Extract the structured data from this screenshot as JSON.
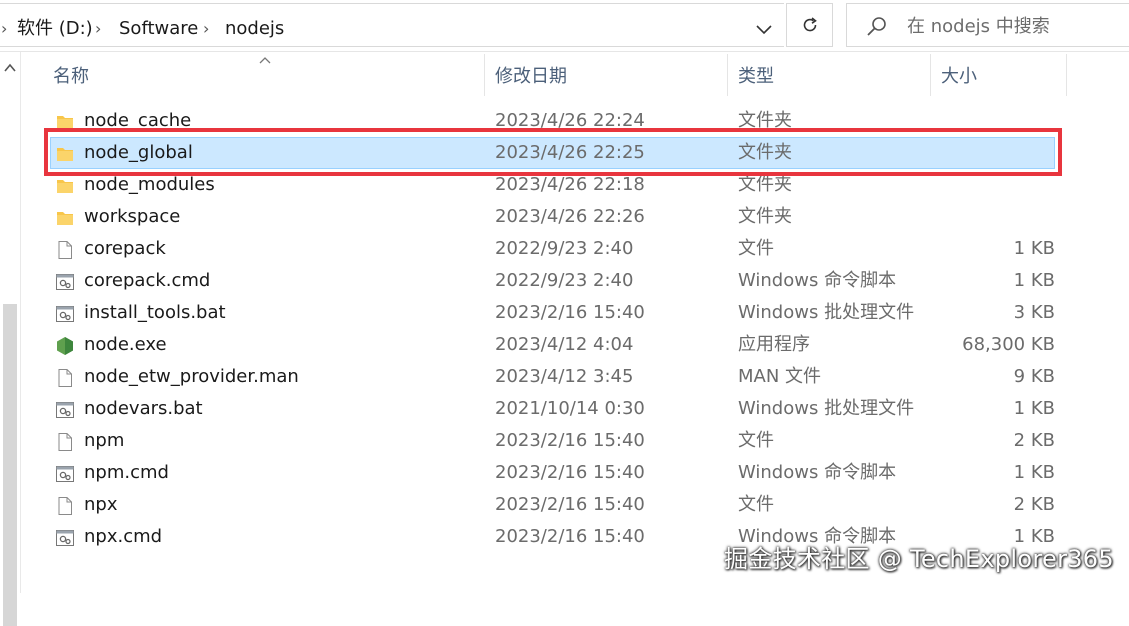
{
  "address_bar": {
    "breadcrumbs": [
      "软件 (D:)",
      "Software",
      "nodejs"
    ],
    "search_placeholder": "在 nodejs 中搜索"
  },
  "columns": {
    "name": "名称",
    "date_modified": "修改日期",
    "type": "类型",
    "size": "大小"
  },
  "files": [
    {
      "name": "node_cache",
      "date": "2023/4/26 22:24",
      "type": "文件夹",
      "size": "",
      "icon": "folder-icon"
    },
    {
      "name": "node_global",
      "date": "2023/4/26 22:25",
      "type": "文件夹",
      "size": "",
      "icon": "folder-icon",
      "selected": true
    },
    {
      "name": "node_modules",
      "date": "2023/4/26 22:18",
      "type": "文件夹",
      "size": "",
      "icon": "folder-icon"
    },
    {
      "name": "workspace",
      "date": "2023/4/26 22:26",
      "type": "文件夹",
      "size": "",
      "icon": "folder-icon"
    },
    {
      "name": "corepack",
      "date": "2022/9/23 2:40",
      "type": "文件",
      "size": "1 KB",
      "icon": "file-icon"
    },
    {
      "name": "corepack.cmd",
      "date": "2022/9/23 2:40",
      "type": "Windows 命令脚本",
      "size": "1 KB",
      "icon": "script-icon"
    },
    {
      "name": "install_tools.bat",
      "date": "2023/2/16 15:40",
      "type": "Windows 批处理文件",
      "size": "3 KB",
      "icon": "script-icon"
    },
    {
      "name": "node.exe",
      "date": "2023/4/12 4:04",
      "type": "应用程序",
      "size": "68,300 KB",
      "icon": "nodejs-icon"
    },
    {
      "name": "node_etw_provider.man",
      "date": "2023/4/12 3:45",
      "type": "MAN 文件",
      "size": "9 KB",
      "icon": "file-icon"
    },
    {
      "name": "nodevars.bat",
      "date": "2021/10/14 0:30",
      "type": "Windows 批处理文件",
      "size": "1 KB",
      "icon": "script-icon"
    },
    {
      "name": "npm",
      "date": "2023/2/16 15:40",
      "type": "文件",
      "size": "2 KB",
      "icon": "file-icon"
    },
    {
      "name": "npm.cmd",
      "date": "2023/2/16 15:40",
      "type": "Windows 命令脚本",
      "size": "1 KB",
      "icon": "script-icon"
    },
    {
      "name": "npx",
      "date": "2023/2/16 15:40",
      "type": "文件",
      "size": "2 KB",
      "icon": "file-icon"
    },
    {
      "name": "npx.cmd",
      "date": "2023/2/16 15:40",
      "type": "Windows 命令脚本",
      "size": "1 KB",
      "icon": "script-icon"
    }
  ],
  "watermark": "掘金技术社区 @ TechExplorer365",
  "colors": {
    "selection": "#cce8ff",
    "highlight_box": "#e8353e",
    "folder": "#f8c64a",
    "nodejs": "#5fa04e",
    "header_text": "#4c607a"
  }
}
